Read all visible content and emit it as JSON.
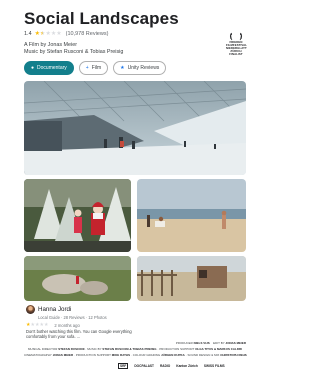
{
  "header": {
    "title": "Social Landscapes",
    "rating_value": "1.4",
    "rating_count": "(10,978 Reviews)",
    "stars": [
      "full",
      "half",
      "empty",
      "empty",
      "empty"
    ],
    "credit_line_1": "A Film by Jonas Meier",
    "credit_line_2": "Music by Stefan Rusconi & Tobias Preisig"
  },
  "laurel": {
    "lines": [
      "FRIEDEN",
      "FILMFESTIVAL",
      "NIEDERGLATT",
      "ZÜRICH",
      "FINALIST"
    ]
  },
  "chips": [
    {
      "label": "Documentary",
      "icon": "location-pin-icon",
      "active": true
    },
    {
      "label": "Film",
      "icon": "plus-icon",
      "active": false
    },
    {
      "label": "Unity Reviews",
      "icon": "star-icon",
      "active": false
    }
  ],
  "photos": [
    {
      "name": "photo-ski-hall",
      "alt": "indoor ski hall"
    },
    {
      "name": "photo-santa",
      "alt": "christmas market santa"
    },
    {
      "name": "photo-beach",
      "alt": "beach"
    },
    {
      "name": "photo-rocks",
      "alt": "rocks"
    },
    {
      "name": "photo-fence",
      "alt": "fence"
    }
  ],
  "review": {
    "name": "Hanna Jordi",
    "meta": "Local Guide · 28 Reviews · 12 Photos",
    "stars": [
      "full",
      "empty",
      "empty",
      "empty",
      "empty"
    ],
    "time": "2 months ago",
    "text": "Don't bother watching this film. You can Google everything comfortably from your sofa. ..."
  },
  "billing": {
    "line1_a": "PRODUCER",
    "line1_a_name": "NIELS VIJS",
    "line1_b": "EDIT BY",
    "line1_b_name": "JONAS MEIER",
    "line2_a": "MUSICAL DIRECTOR",
    "line2_a_name": "STEFAN RUSCONI",
    "line2_b": "MUSIC BY",
    "line2_b_name": "STEFAN RUSCONI & TOBIAS PREISIG",
    "line2_c": "PRODUCTION SUPPORT",
    "line2_c_name": "OLGA TITUS & MARKUS CALDRI",
    "line3_a": "CINEMATOGRAPHY",
    "line3_a_name": "JONAS MEIER",
    "line3_b": "PRODUCTION SUPPORT",
    "line3_b_name": "MIKE RATHS",
    "line3_c": "COLOUR GRADING",
    "line3_c_name": "JÜRGEN KUPKA",
    "line3_d": "SOUND DESIGN & MIX",
    "line3_d_name": "CHRISTOPH REHS"
  },
  "logos": [
    "SRF",
    "DOCPALAST",
    "RADIO",
    "Kanton Zürich",
    "SWISS FILMS"
  ],
  "colors": {
    "accent": "#137f8c",
    "star": "#fbbc04"
  }
}
